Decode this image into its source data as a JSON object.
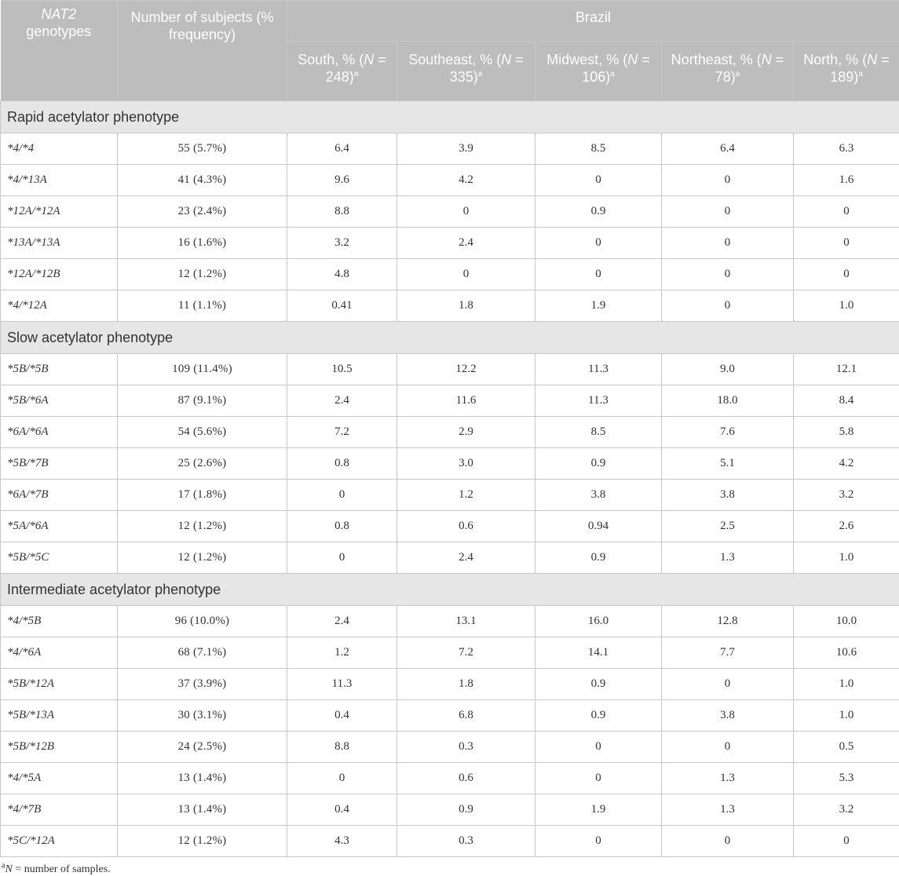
{
  "header": {
    "genotypes_italic": "NAT2",
    "genotypes_rest": "genotypes",
    "subjects": "Number of subjects (% frequency)",
    "country": "Brazil",
    "regions": [
      {
        "label": "South, % (",
        "n_italic": "N",
        "n_rest": " = 248)",
        "sup": "a"
      },
      {
        "label": "Southeast, % (",
        "n_italic": "N",
        "n_rest": " = 335)",
        "sup": "a"
      },
      {
        "label": "Midwest, % (",
        "n_italic": "N",
        "n_rest": " = 106)",
        "sup": "a"
      },
      {
        "label": "Northeast, % (",
        "n_italic": "N",
        "n_rest": " = 78)",
        "sup": "a"
      },
      {
        "label": "North, % (",
        "n_italic": "N",
        "n_rest": " = 189)",
        "sup": "a"
      }
    ]
  },
  "groups": [
    {
      "title": "Rapid acetylator phenotype",
      "rows": [
        {
          "genotype": "*4/*4",
          "subjects": "55 (5.7%)",
          "values": [
            "6.4",
            "3.9",
            "8.5",
            "6.4",
            "6.3"
          ]
        },
        {
          "genotype": "*4/*13A",
          "subjects": "41 (4.3%)",
          "values": [
            "9.6",
            "4.2",
            "0",
            "0",
            "1.6"
          ]
        },
        {
          "genotype": "*12A/*12A",
          "subjects": "23 (2.4%)",
          "values": [
            "8.8",
            "0",
            "0.9",
            "0",
            "0"
          ]
        },
        {
          "genotype": "*13A/*13A",
          "subjects": "16 (1.6%)",
          "values": [
            "3.2",
            "2.4",
            "0",
            "0",
            "0"
          ]
        },
        {
          "genotype": "*12A/*12B",
          "subjects": "12 (1.2%)",
          "values": [
            "4.8",
            "0",
            "0",
            "0",
            "0"
          ]
        },
        {
          "genotype": "*4/*12A",
          "subjects": "11 (1.1%)",
          "values": [
            "0.41",
            "1.8",
            "1.9",
            "0",
            "1.0"
          ]
        }
      ]
    },
    {
      "title": "Slow acetylator phenotype",
      "rows": [
        {
          "genotype": "*5B/*5B",
          "subjects": "109 (11.4%)",
          "values": [
            "10.5",
            "12.2",
            "11.3",
            "9.0",
            "12.1"
          ]
        },
        {
          "genotype": "*5B/*6A",
          "subjects": "87 (9.1%)",
          "values": [
            "2.4",
            "11.6",
            "11.3",
            "18.0",
            "8.4"
          ]
        },
        {
          "genotype": "*6A/*6A",
          "subjects": "54 (5.6%)",
          "values": [
            "7.2",
            "2.9",
            "8.5",
            "7.6",
            "5.8"
          ]
        },
        {
          "genotype": "*5B/*7B",
          "subjects": "25 (2.6%)",
          "values": [
            "0.8",
            "3.0",
            "0.9",
            "5.1",
            "4.2"
          ]
        },
        {
          "genotype": "*6A/*7B",
          "subjects": "17 (1.8%)",
          "values": [
            "0",
            "1.2",
            "3.8",
            "3.8",
            "3.2"
          ]
        },
        {
          "genotype": "*5A/*6A",
          "subjects": "12 (1.2%)",
          "values": [
            "0.8",
            "0.6",
            "0.94",
            "2.5",
            "2.6"
          ]
        },
        {
          "genotype": "*5B/*5C",
          "subjects": "12 (1.2%)",
          "values": [
            "0",
            "2.4",
            "0.9",
            "1.3",
            "1.0"
          ]
        }
      ]
    },
    {
      "title": "Intermediate acetylator phenotype",
      "rows": [
        {
          "genotype": "*4/*5B",
          "subjects": "96 (10.0%)",
          "values": [
            "2.4",
            "13.1",
            "16.0",
            "12.8",
            "10.0"
          ]
        },
        {
          "genotype": "*4/*6A",
          "subjects": "68 (7.1%)",
          "values": [
            "1.2",
            "7.2",
            "14.1",
            "7.7",
            "10.6"
          ]
        },
        {
          "genotype": "*5B/*12A",
          "subjects": "37 (3.9%)",
          "values": [
            "11.3",
            "1.8",
            "0.9",
            "0",
            "1.0"
          ]
        },
        {
          "genotype": "*5B/*13A",
          "subjects": "30 (3.1%)",
          "values": [
            "0.4",
            "6.8",
            "0.9",
            "3.8",
            "1.0"
          ]
        },
        {
          "genotype": "*5B/*12B",
          "subjects": "24 (2.5%)",
          "values": [
            "8.8",
            "0.3",
            "0",
            "0",
            "0.5"
          ]
        },
        {
          "genotype": "*4/*5A",
          "subjects": "13 (1.4%)",
          "values": [
            "0",
            "0.6",
            "0",
            "1.3",
            "5.3"
          ]
        },
        {
          "genotype": "*4/*7B",
          "subjects": "13 (1.4%)",
          "values": [
            "0.4",
            "0.9",
            "1.9",
            "1.3",
            "3.2"
          ]
        },
        {
          "genotype": "*5C/*12A",
          "subjects": "12 (1.2%)",
          "values": [
            "4.3",
            "0.3",
            "0",
            "0",
            "0"
          ]
        }
      ]
    }
  ],
  "footnote": {
    "sup": "a",
    "italic": "N",
    "text": " = number of samples."
  }
}
